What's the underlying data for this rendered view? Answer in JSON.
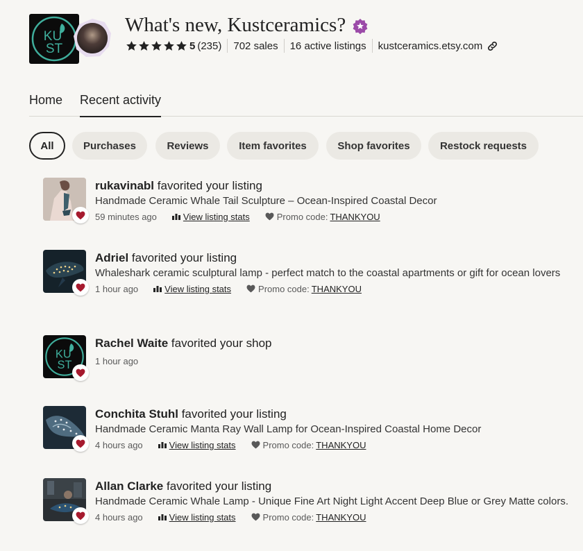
{
  "header": {
    "title": "What's new, Kustceramics?",
    "rating_value": "5",
    "rating_count": "(235)",
    "sales": "702 sales",
    "active_listings": "16 active listings",
    "shop_url": "kustceramics.etsy.com",
    "logo_text_top": "KU",
    "logo_text_bottom": "ST",
    "star_count": 5
  },
  "tabs": [
    {
      "label": "Home"
    },
    {
      "label": "Recent activity",
      "active": true
    }
  ],
  "filters": [
    {
      "label": "All",
      "active": true
    },
    {
      "label": "Purchases"
    },
    {
      "label": "Reviews"
    },
    {
      "label": "Item favorites"
    },
    {
      "label": "Shop favorites"
    },
    {
      "label": "Restock requests"
    }
  ],
  "feed": [
    {
      "user": "rukavinabl",
      "action": "favorited your listing",
      "listing": "Handmade Ceramic Whale Tail Sculpture – Ocean-Inspired Coastal Decor",
      "time": "59 minutes ago",
      "stats_label": "View listing stats",
      "promo_label": "Promo code:",
      "promo_code": "THANKYOU"
    },
    {
      "user": "Adriel",
      "action": "favorited your listing",
      "listing": "Whaleshark ceramic sculptural lamp - perfect match to the coastal apartments or gift for ocean lovers",
      "time": "1 hour ago",
      "stats_label": "View listing stats",
      "promo_label": "Promo code:",
      "promo_code": "THANKYOU"
    },
    {
      "user": "Rachel Waite",
      "action": "favorited your shop",
      "time": "1 hour ago"
    },
    {
      "user": "Conchita Stuhl",
      "action": "favorited your listing",
      "listing": "Handmade Ceramic Manta Ray Wall Lamp for Ocean-Inspired Coastal Home Decor",
      "time": "4 hours ago",
      "stats_label": "View listing stats",
      "promo_label": "Promo code:",
      "promo_code": "THANKYOU"
    },
    {
      "user": "Allan Clarke",
      "action": "favorited your listing",
      "listing": "Handmade Ceramic Whale Lamp - Unique Fine Art Night Light Accent Deep Blue or Grey Matte colors.",
      "time": "4 hours ago",
      "stats_label": "View listing stats",
      "promo_label": "Promo code:",
      "promo_code": "THANKYOU"
    }
  ],
  "colors": {
    "accent_purple": "#9b4aa8",
    "heart_red": "#a61a2e",
    "logo_teal": "#3fae9c",
    "background": "#f7f6f3",
    "chip": "#ebe9e4"
  }
}
